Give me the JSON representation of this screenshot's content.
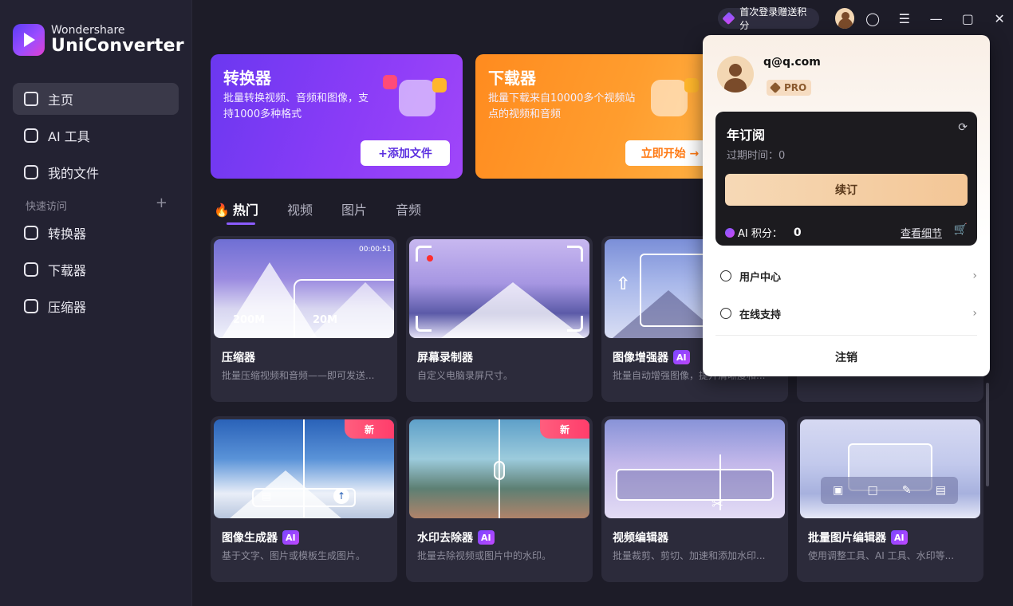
{
  "brand": {
    "top": "Wondershare",
    "bottom": "UniConverter"
  },
  "nav": [
    {
      "label": "主页",
      "icon": "home-icon",
      "active": true
    },
    {
      "label": "AI 工具",
      "icon": "ai-tools-icon",
      "active": false
    },
    {
      "label": "我的文件",
      "icon": "files-icon",
      "active": false
    }
  ],
  "quick_access": {
    "label": "快速访问",
    "add": "+"
  },
  "nav2": [
    {
      "label": "转换器",
      "icon": "converter-icon"
    },
    {
      "label": "下载器",
      "icon": "downloader-icon"
    },
    {
      "label": "压缩器",
      "icon": "compressor-icon"
    }
  ],
  "titlebar": {
    "reward": "首次登录赠送积分"
  },
  "hero": {
    "converter": {
      "title": "转换器",
      "desc": "批量转换视频、音频和图像，支持1000多种格式",
      "button": "+添加文件"
    },
    "downloader": {
      "title": "下载器",
      "desc": "批量下载来自10000多个视频站点的视频和音频",
      "button": "立即开始 →"
    }
  },
  "tabs": [
    "热门",
    "视频",
    "图片",
    "音频"
  ],
  "cards": [
    {
      "title": "压缩器",
      "desc": "批量压缩视频和音频——即可发送...",
      "ai": false,
      "new": false,
      "size_from": "200M",
      "size_to": "20M",
      "time": "00:00:51"
    },
    {
      "title": "屏幕录制器",
      "desc": "自定义电脑录屏尺寸。",
      "ai": false,
      "new": false
    },
    {
      "title": "图像增强器",
      "desc": "批量自动增强图像，提升清晰度和...",
      "ai": true,
      "new": false
    },
    {
      "title": "图像生成器",
      "desc": "基于文字、图片或模板生成图片。",
      "ai": true,
      "new": true
    },
    {
      "title": "水印去除器",
      "desc": "批量去除视频或图片中的水印。",
      "ai": true,
      "new": true
    },
    {
      "title": "视频编辑器",
      "desc": "批量裁剪、剪切、加速和添加水印...",
      "ai": false,
      "new": false
    },
    {
      "title": "批量图片编辑器",
      "desc": "使用调整工具、AI 工具、水印等...",
      "ai": true,
      "new": false
    }
  ],
  "badges": {
    "ai": "AI",
    "new": "新"
  },
  "account": {
    "email": "q@q.com",
    "tier": "PRO",
    "plan": "年订阅",
    "expiry_label": "过期时间：",
    "expiry_value": "0",
    "renew": "续订",
    "credits_label": "AI 积分：",
    "credits_value": "0",
    "details": "查看细节",
    "user_center": "用户中心",
    "support": "在线支持",
    "logout": "注销"
  }
}
